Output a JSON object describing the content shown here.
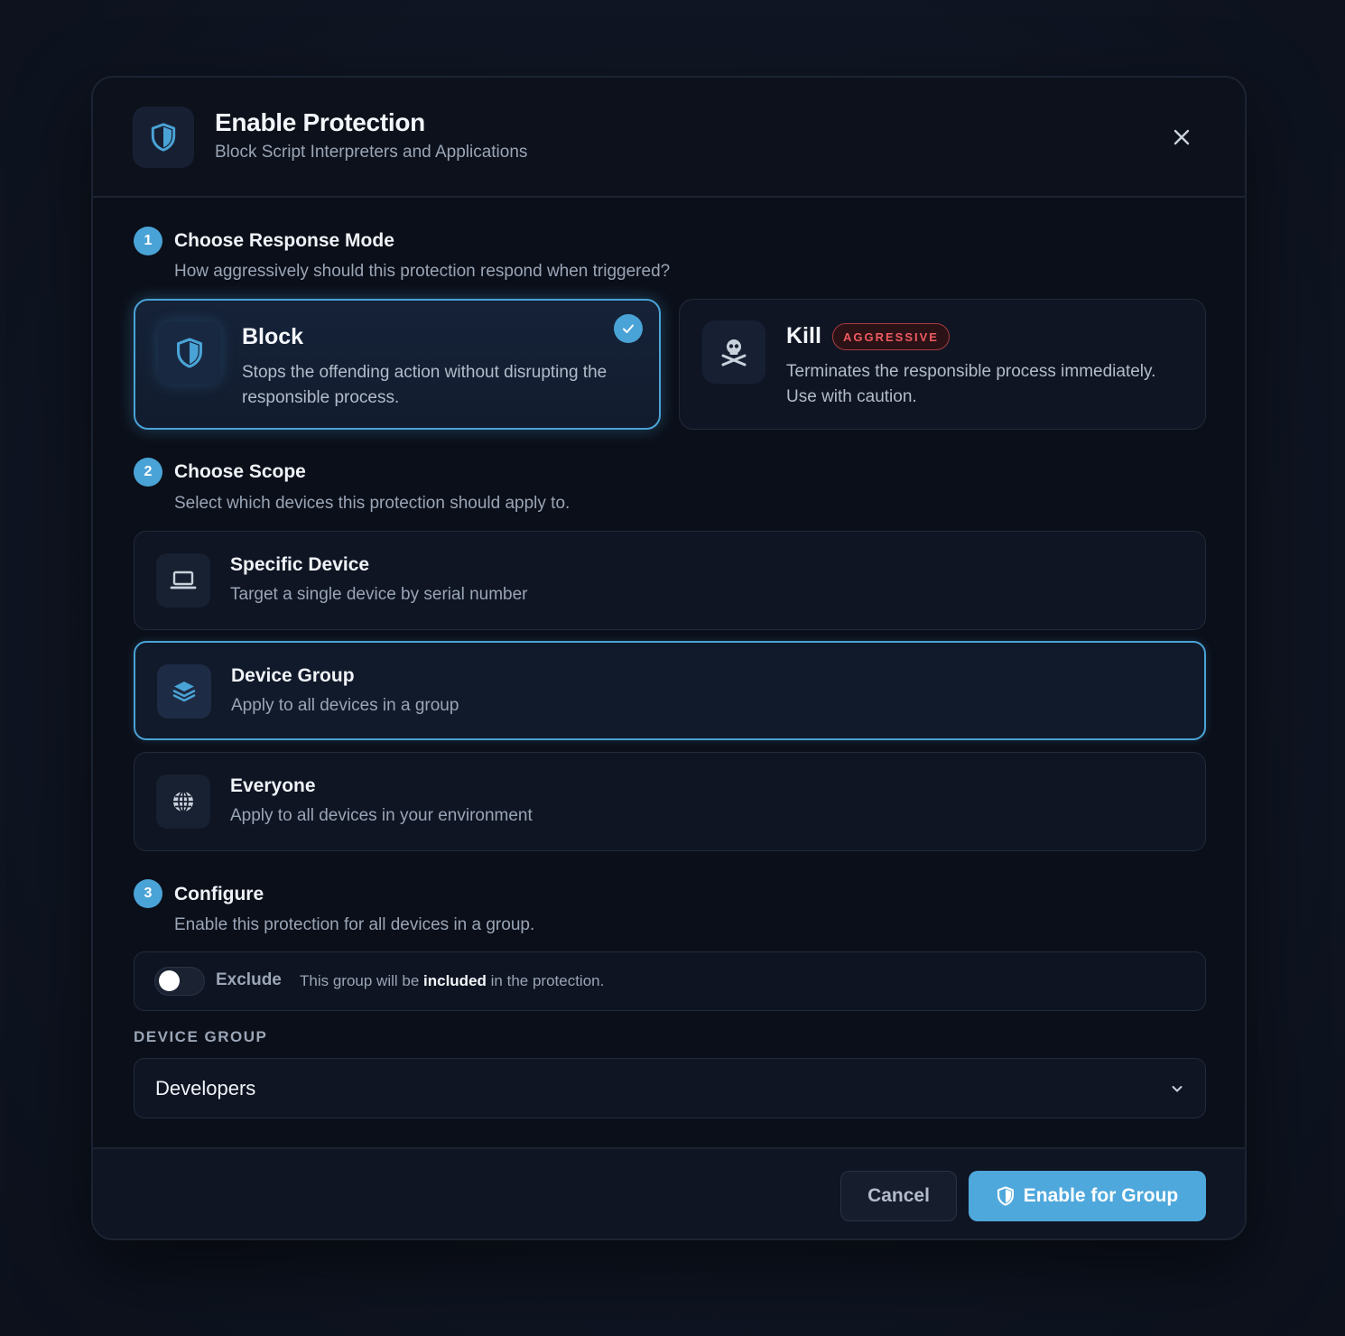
{
  "header": {
    "title": "Enable Protection",
    "subtitle": "Block Script Interpreters and Applications",
    "icon": "shield-icon",
    "close_icon": "close-icon"
  },
  "steps": [
    {
      "number": "1",
      "title": "Choose Response Mode",
      "description": "How aggressively should this protection respond when triggered?"
    },
    {
      "number": "2",
      "title": "Choose Scope",
      "description": "Select which devices this protection should apply to."
    },
    {
      "number": "3",
      "title": "Configure",
      "description": "Enable this protection for all devices in a group."
    }
  ],
  "modes": [
    {
      "title": "Block",
      "description": "Stops the offending action without disrupting the responsible process.",
      "icon": "shield-icon",
      "selected": true
    },
    {
      "title": "Kill",
      "badge": "AGGRESSIVE",
      "description": "Terminates the responsible process immediately. Use with caution.",
      "icon": "skull-crossbones-icon",
      "selected": false
    }
  ],
  "scopes": [
    {
      "title": "Specific Device",
      "description": "Target a single device by serial number",
      "icon": "laptop-icon",
      "selected": false
    },
    {
      "title": "Device Group",
      "description": "Apply to all devices in a group",
      "icon": "layers-icon",
      "selected": true
    },
    {
      "title": "Everyone",
      "description": "Apply to all devices in your environment",
      "icon": "globe-icon",
      "selected": false
    }
  ],
  "configure": {
    "exclude_label": "Exclude",
    "exclude_enabled": false,
    "exclude_text_before": "This group will be ",
    "exclude_text_bold": "included",
    "exclude_text_after": " in the protection.",
    "field_label": "DEVICE GROUP",
    "selected_group": "Developers"
  },
  "footer": {
    "cancel_label": "Cancel",
    "enable_label": "Enable for Group"
  },
  "colors": {
    "accent": "#4aa3d6",
    "danger": "#ef5a5f",
    "background": "#0b0f19"
  }
}
